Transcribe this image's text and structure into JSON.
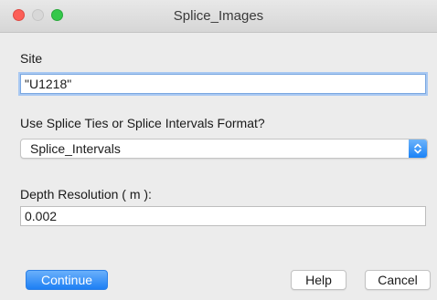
{
  "window": {
    "title": "Splice_Images"
  },
  "site": {
    "label": "Site",
    "value": "\"U1218\""
  },
  "format": {
    "label": "Use Splice Ties or Splice Intervals Format?",
    "selected": "Splice_Intervals"
  },
  "depth": {
    "label": "Depth Resolution ( m ):",
    "value": "0.002"
  },
  "buttons": {
    "continue": "Continue",
    "help": "Help",
    "cancel": "Cancel"
  },
  "colors": {
    "accent": "#1d7ff4",
    "close": "#fc5f57",
    "zoom": "#34c84a",
    "window_bg": "#ececec"
  }
}
